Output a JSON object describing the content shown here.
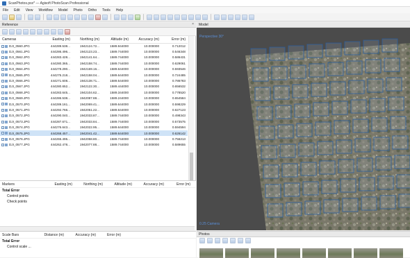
{
  "window": {
    "title": "ScanPhotos.psx* — Agisoft PhotoScan Professional"
  },
  "menu": [
    "File",
    "Edit",
    "View",
    "Workflow",
    "Model",
    "Photo",
    "Ortho",
    "Tools",
    "Help"
  ],
  "reference": {
    "panel_title": "Reference",
    "panel_controls": "×",
    "columns": [
      "Cameras",
      "Easting (m)",
      "Northing (m)",
      "Altitude (m)",
      "Accuracy (m)",
      "Error (m)"
    ],
    "rows": [
      {
        "name": "DJI_0560.JPG",
        "easting": "444289.538...",
        "northing": "1942124.72...",
        "altitude": "1589.944000",
        "accuracy": "10.000000",
        "error": "0.712012"
      },
      {
        "name": "DJI_0561.JPG",
        "easting": "444286.496...",
        "northing": "1942123.23...",
        "altitude": "1589.744000",
        "accuracy": "10.000000",
        "error": "0.546348"
      },
      {
        "name": "DJI_0562.JPG",
        "easting": "444283.428...",
        "northing": "1942141.64...",
        "altitude": "1589.744000",
        "accuracy": "10.000000",
        "error": "0.586431"
      },
      {
        "name": "DJI_0563.JPG",
        "easting": "444280.365...",
        "northing": "1942158.74...",
        "altitude": "1589.744000",
        "accuracy": "10.000000",
        "error": "0.629061"
      },
      {
        "name": "DJI_0564.JPG",
        "easting": "444278.290...",
        "northing": "1942169.16...",
        "altitude": "1589.644000",
        "accuracy": "10.000000",
        "error": "0.593546"
      },
      {
        "name": "DJI_0565.JPG",
        "easting": "444275.218...",
        "northing": "1942158.04...",
        "altitude": "1589.644000",
        "accuracy": "10.000000",
        "error": "0.724485"
      },
      {
        "name": "DJI_0566.JPG",
        "easting": "444271.608...",
        "northing": "1942138.71...",
        "altitude": "1589.544000",
        "accuracy": "10.000000",
        "error": "0.786783"
      },
      {
        "name": "DJI_0567.JPG",
        "easting": "444280.652...",
        "northing": "1942122.30...",
        "altitude": "1589.444000",
        "accuracy": "10.000000",
        "error": "0.656532"
      },
      {
        "name": "DJI_0568.JPG",
        "easting": "444283.645...",
        "northing": "1942104.62...",
        "altitude": "1589.344000",
        "accuracy": "10.000000",
        "error": "0.778520"
      },
      {
        "name": "DJI_0569.JPG",
        "easting": "444286.538...",
        "northing": "1942087.88...",
        "altitude": "1589.244000",
        "accuracy": "10.000000",
        "error": "0.654584"
      },
      {
        "name": "DJI_0570.JPG",
        "easting": "444289.161...",
        "northing": "1942069.41...",
        "altitude": "1589.644000",
        "accuracy": "10.000000",
        "error": "0.598229"
      },
      {
        "name": "DJI_0571.JPG",
        "easting": "444292.766...",
        "northing": "1942051.22...",
        "altitude": "1589.644000",
        "accuracy": "10.000000",
        "error": "0.627123"
      },
      {
        "name": "DJI_0572.JPG",
        "easting": "444290.040...",
        "northing": "1942033.87...",
        "altitude": "1589.744000",
        "accuracy": "10.000000",
        "error": "0.498343"
      },
      {
        "name": "DJI_0573.JPG",
        "easting": "444287.671...",
        "northing": "1942033.84...",
        "altitude": "1589.744000",
        "accuracy": "10.000000",
        "error": "0.573575"
      },
      {
        "name": "DJI_0574.JPG",
        "easting": "444276.643...",
        "northing": "1942022.95...",
        "altitude": "1589.644000",
        "accuracy": "10.000000",
        "error": "0.594594"
      },
      {
        "name": "DJI_0575.JPG",
        "easting": "444268.457...",
        "northing": "1942041.42...",
        "altitude": "1589.644000",
        "accuracy": "10.000000",
        "error": "0.626142"
      },
      {
        "name": "DJI_0576.JPG",
        "easting": "444265.495...",
        "northing": "1942058.80...",
        "altitude": "1589.744000",
        "accuracy": "10.000000",
        "error": "0.756213"
      },
      {
        "name": "DJI_0577.JPG",
        "easting": "444262.478...",
        "northing": "1942077.88...",
        "altitude": "1589.744000",
        "accuracy": "10.000000",
        "error": "0.589655"
      }
    ],
    "selected_row": 15
  },
  "markers": {
    "columns": [
      "Markers",
      "Easting (m)",
      "Northing (m)",
      "Altitude (m)",
      "Accuracy (m)",
      "Error (m)"
    ],
    "total_error": "Total Error",
    "control_points": "Control points",
    "check_points": "Check points"
  },
  "scalebars": {
    "columns": [
      "Scale Bars",
      "Distance (m)",
      "Accuracy (m)",
      "Error (m)"
    ],
    "total_error": "Total Error",
    "control_scale": "Control scale ..."
  },
  "model": {
    "panel_title": "Model",
    "view_label": "Perspective 30°",
    "footer_label": "0.25 Camera"
  },
  "photos": {
    "panel_title": "Photos"
  },
  "colors": {
    "selection": "#cfe3f7",
    "viewport_bg": "#4b4b4b",
    "camera_frame": "#2c5f9e"
  }
}
